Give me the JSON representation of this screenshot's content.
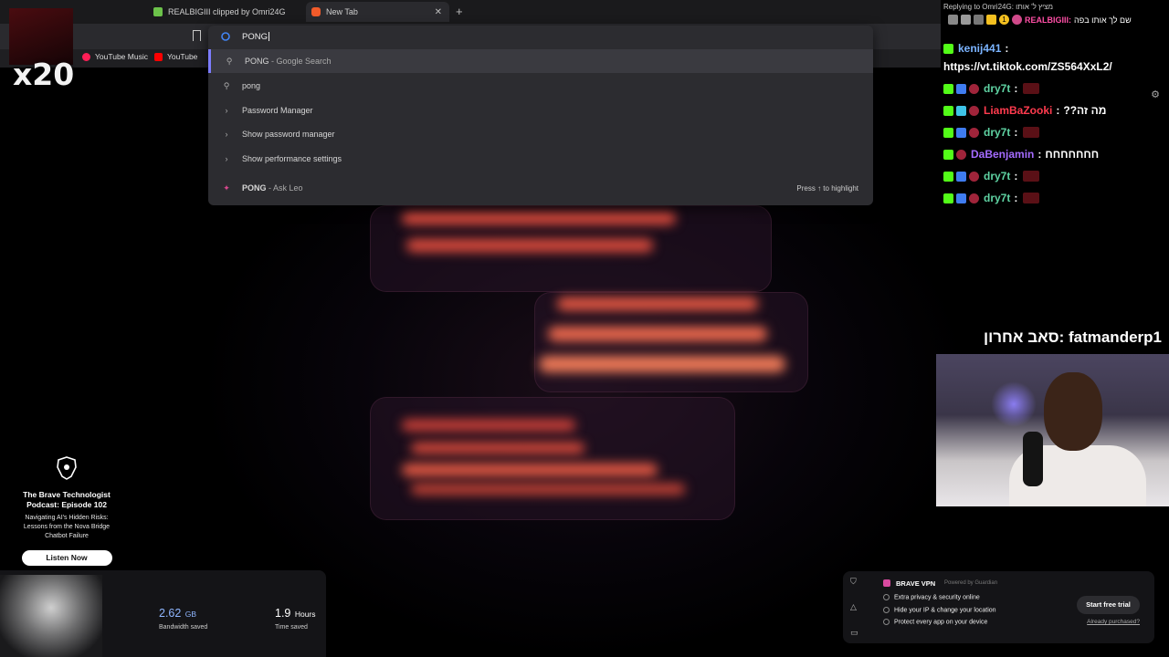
{
  "browser": {
    "tabs": [
      {
        "label": "REALBIGIII clipped by Omri24G",
        "active": false
      },
      {
        "label": "New Tab",
        "active": true
      }
    ],
    "new_tab_symbol": "+",
    "close_symbol": "✕",
    "bookmarks": [
      {
        "label": "YouTube Music",
        "color": "#ff1e56"
      },
      {
        "label": "YouTube",
        "color": "#ff0000"
      }
    ]
  },
  "omnibox": {
    "query": "PONG",
    "suggestions": [
      {
        "icon": "search-icon",
        "title": "PONG",
        "sub": " - Google Search",
        "selected": true
      },
      {
        "icon": "search-icon",
        "title": "pong",
        "sub": "",
        "selected": false
      },
      {
        "icon": "chevron-right-icon",
        "title": "Password Manager",
        "sub": "",
        "selected": false
      },
      {
        "icon": "chevron-right-icon",
        "title": "Show password manager",
        "sub": "",
        "selected": false
      },
      {
        "icon": "chevron-right-icon",
        "title": "Show performance settings",
        "sub": "",
        "selected": false
      },
      {
        "icon": "leo-icon",
        "title": "PONG",
        "sub": " - Ask Leo",
        "selected": false
      }
    ],
    "hint": "Press ↑ to highlight"
  },
  "overlay": {
    "multiplier": "x20"
  },
  "promo": {
    "title": "The Brave Technologist Podcast: Episode 102",
    "description": "Navigating AI's Hidden Risks: Lessons from the Nova Bridge Chatbot Failure",
    "button": "Listen Now"
  },
  "stats": {
    "bandwidth_value": "2.62",
    "bandwidth_unit": "GB",
    "bandwidth_label": "Bandwidth saved",
    "time_value": "1.9",
    "time_unit": "Hours",
    "time_label": "Time saved"
  },
  "vpn": {
    "brand": "BRAVE VPN",
    "powered": "Powered by Guardian",
    "features": [
      "Extra privacy & security online",
      "Hide your IP & change your location",
      "Protect every app on your device"
    ],
    "trial_button": "Start free trial",
    "already_link": "Already purchased?"
  },
  "chat": {
    "reply_to": "Replying to Omri24G: מציץ ל' אותו",
    "reply_line_user": "REALBIGIII:",
    "reply_line_text": "שם לך אותו בפה",
    "reply_count": "1",
    "messages": [
      {
        "user": "kenij441",
        "text": "",
        "color": "#7bb4ff",
        "emote": false
      },
      {
        "user": "",
        "text": "https://vt.tiktok.com/ZS564XxL2/",
        "color": "#ffffff",
        "emote": false
      },
      {
        "user": "dry7t",
        "text": "",
        "color": "#5fd3a3",
        "emote": true
      },
      {
        "user": "LiamBaZooki",
        "text": "??מה זה",
        "color": "#ff3b4e",
        "emote": false
      },
      {
        "user": "dry7t",
        "text": "",
        "color": "#5fd3a3",
        "emote": true
      },
      {
        "user": "DaBenjamin",
        "text": "חחחחחחח",
        "color": "#a46bff",
        "emote": false
      },
      {
        "user": "dry7t",
        "text": "",
        "color": "#5fd3a3",
        "emote": true
      },
      {
        "user": "dry7t",
        "text": "",
        "color": "#5fd3a3",
        "emote": true
      }
    ],
    "separator": ":"
  },
  "sub_banner": "סאב אחרון: fatmanderp1"
}
